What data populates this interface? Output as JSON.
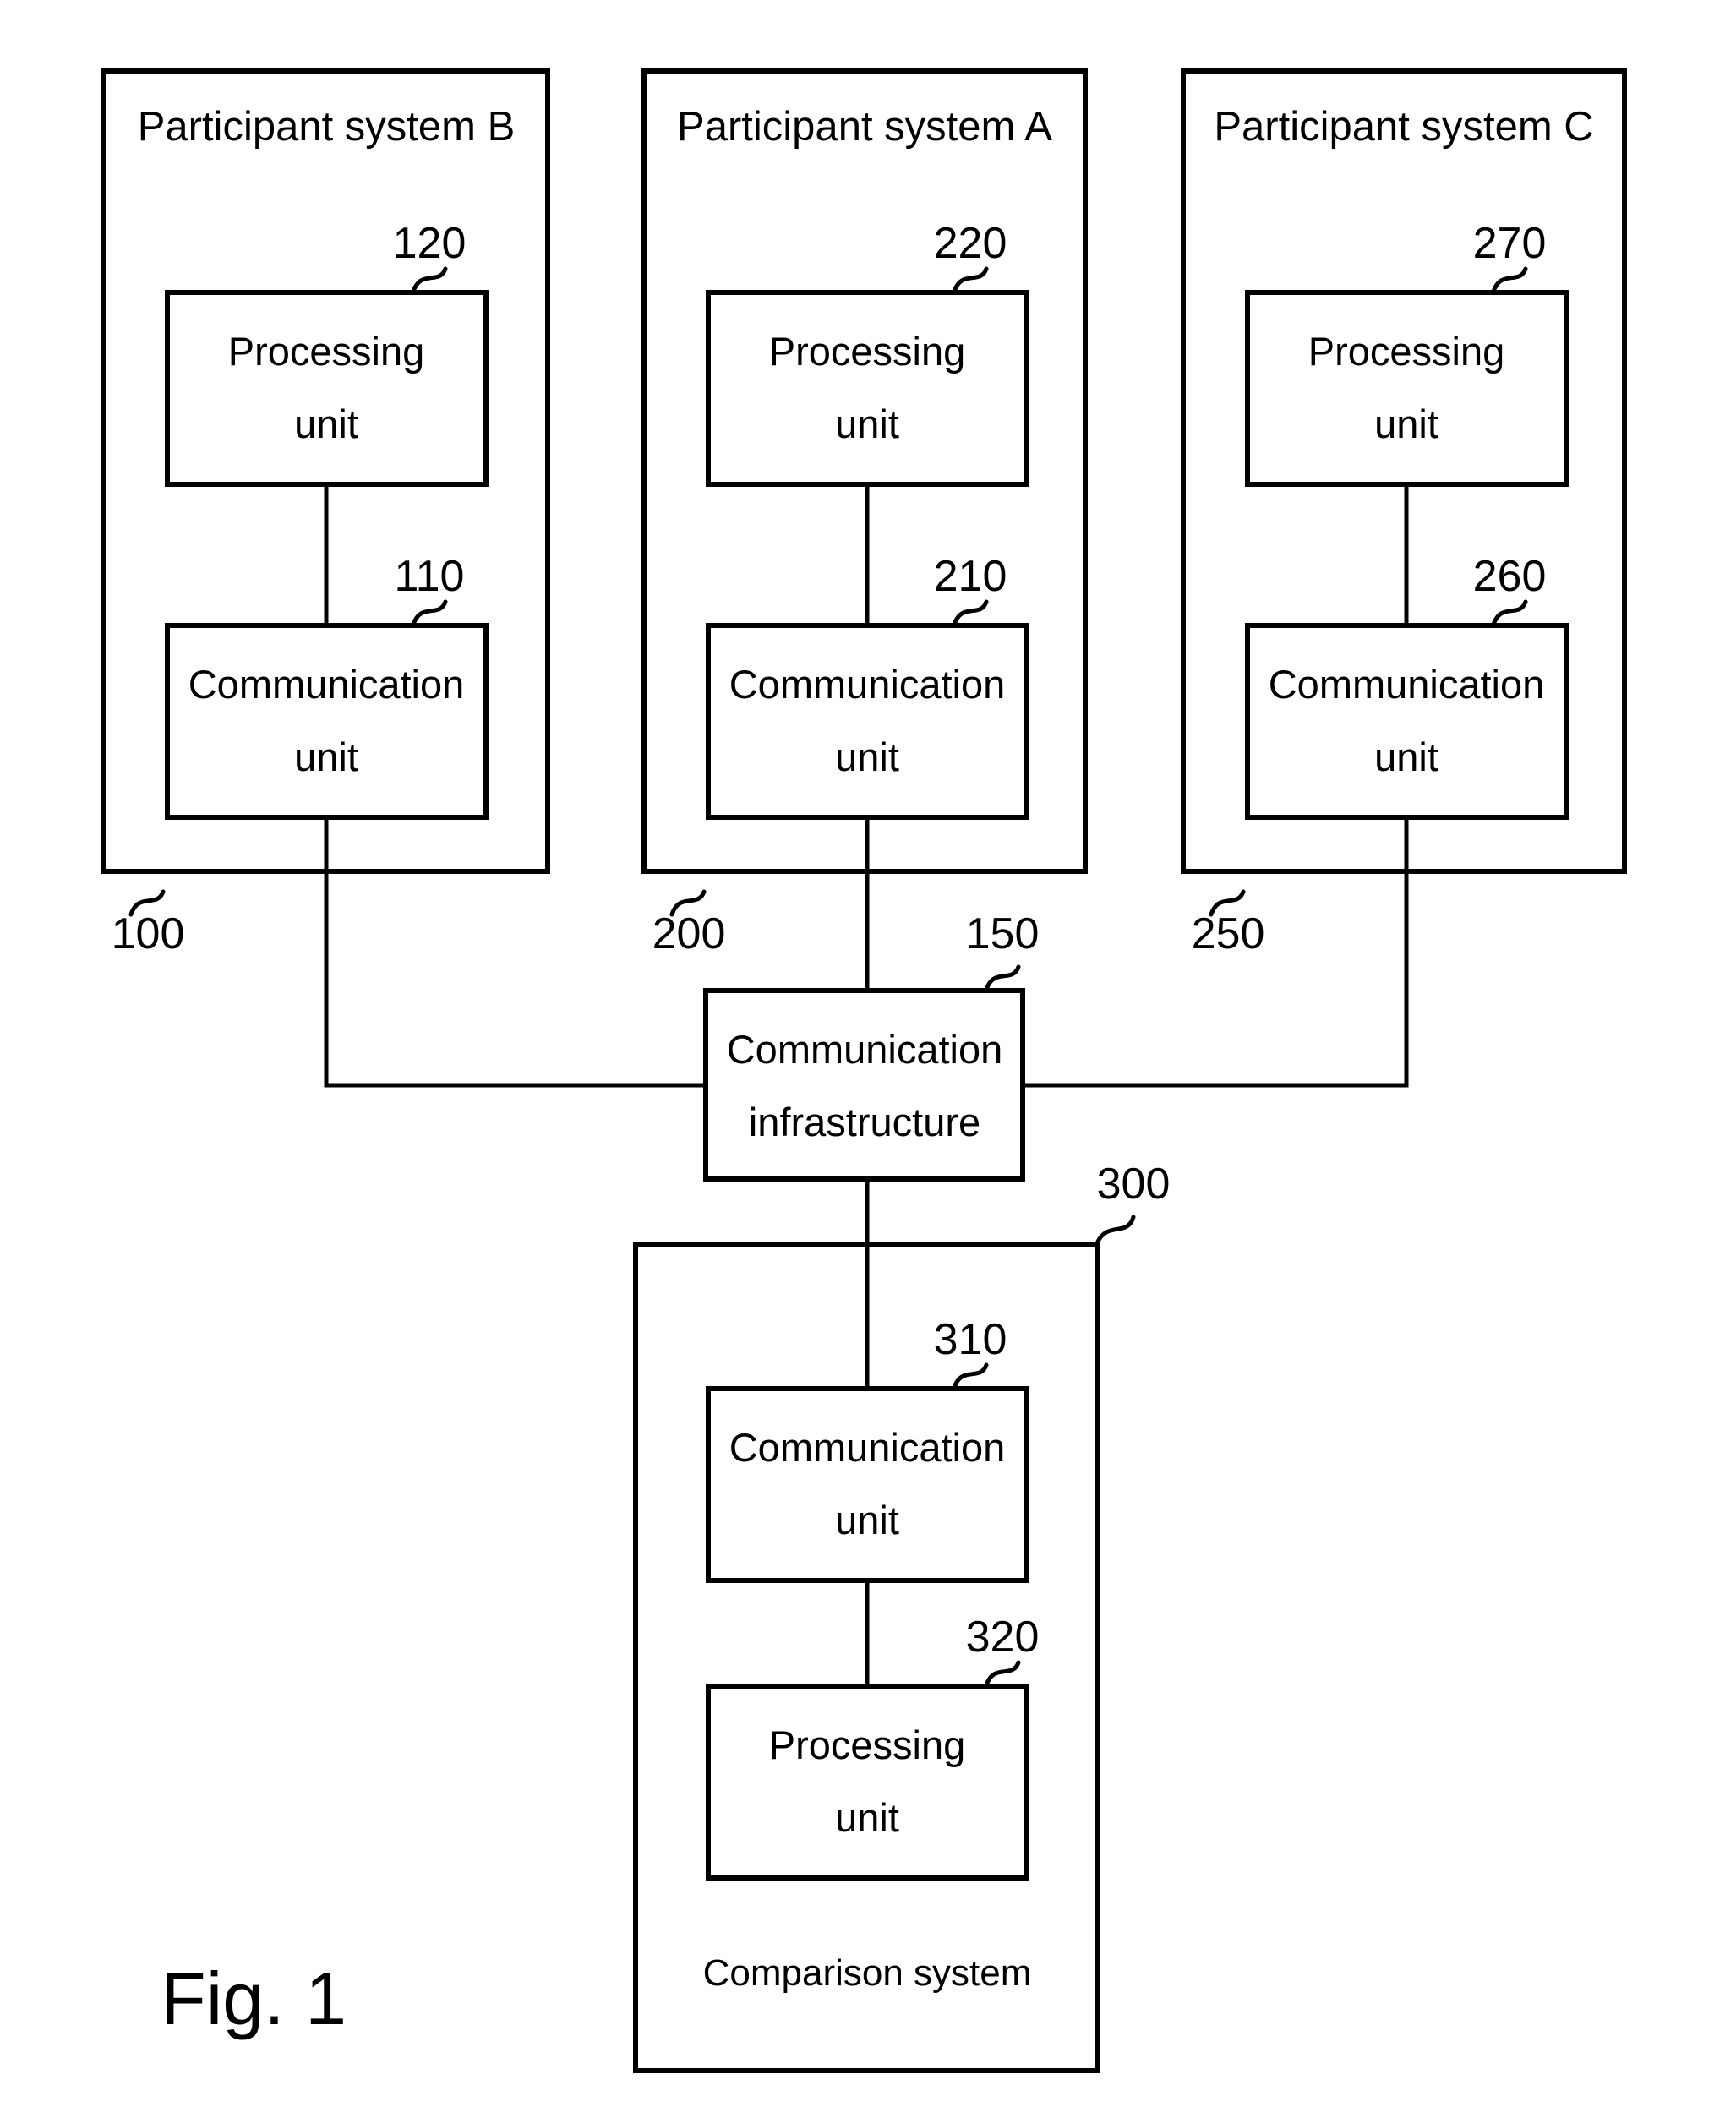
{
  "figure": {
    "caption": "Fig. 1",
    "type": "patent-block-diagram"
  },
  "participant_systems": [
    {
      "title": "Participant system B",
      "system_ref": "100",
      "processing_unit": {
        "line1": "Processing",
        "line2": "unit",
        "ref": "120"
      },
      "communication_unit": {
        "line1": "Communication",
        "line2": "unit",
        "ref": "110"
      }
    },
    {
      "title": "Participant system A",
      "system_ref": "200",
      "processing_unit": {
        "line1": "Processing",
        "line2": "unit",
        "ref": "220"
      },
      "communication_unit": {
        "line1": "Communication",
        "line2": "unit",
        "ref": "210"
      }
    },
    {
      "title": "Participant system C",
      "system_ref": "250",
      "processing_unit": {
        "line1": "Processing",
        "line2": "unit",
        "ref": "270"
      },
      "communication_unit": {
        "line1": "Communication",
        "line2": "unit",
        "ref": "260"
      }
    }
  ],
  "communication_infrastructure": {
    "line1": "Communication",
    "line2": "infrastructure",
    "ref": "150"
  },
  "comparison_system": {
    "title": "Comparison system",
    "system_ref": "300",
    "communication_unit": {
      "line1": "Communication",
      "line2": "unit",
      "ref": "310"
    },
    "processing_unit": {
      "line1": "Processing",
      "line2": "unit",
      "ref": "320"
    }
  },
  "colors": {
    "stroke": "#000000",
    "background": "#ffffff",
    "text": "#000000"
  }
}
